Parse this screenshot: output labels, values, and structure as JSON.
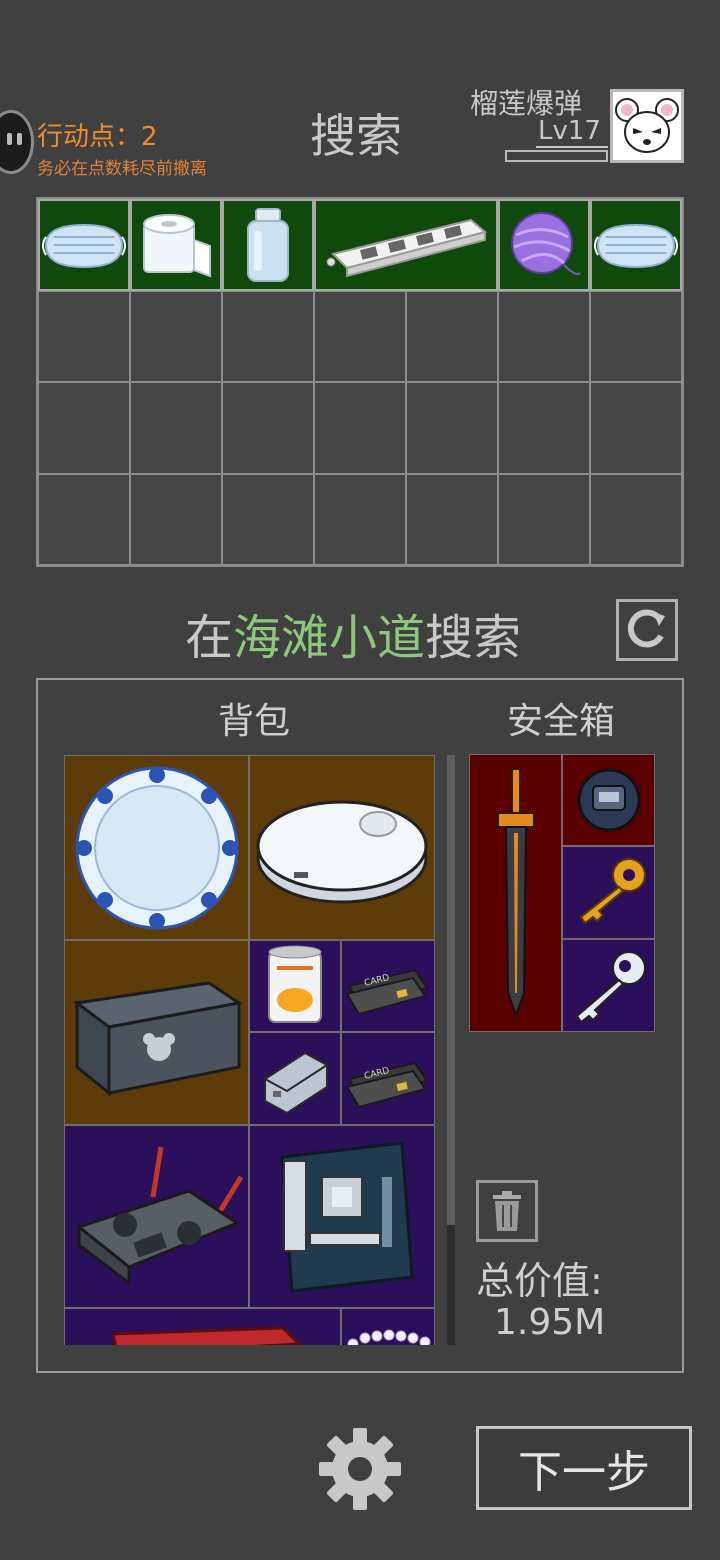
{
  "header": {
    "action_points_label": "行动点：2",
    "warning": "务必在点数耗尽前撤离",
    "title": "搜索",
    "player_name": "榴莲爆弹",
    "player_level": "Lv17"
  },
  "loot": {
    "items": [
      {
        "name": "face-mask",
        "icon": "face-mask-icon"
      },
      {
        "name": "toilet-paper",
        "icon": "toilet-paper-icon"
      },
      {
        "name": "bottle",
        "icon": "bottle-icon"
      },
      {
        "name": "power-strip",
        "icon": "power-strip-icon"
      },
      {
        "name": "yarn-ball",
        "icon": "yarn-ball-icon"
      },
      {
        "name": "face-mask",
        "icon": "face-mask-icon"
      }
    ],
    "grid_columns": 7,
    "grid_rows": 4
  },
  "location": {
    "prefix": "在",
    "place": "海滩小道",
    "suffix": "搜索"
  },
  "inventory": {
    "backpack_title": "背包",
    "safe_title": "安全箱",
    "backpack_items": [
      "porcelain-plate",
      "robot-vacuum",
      "storage-crate",
      "canned-peaches",
      "bank-card",
      "drone-battery",
      "bank-card",
      "remote-controller",
      "motherboard",
      "red-item",
      "pearl-necklace"
    ],
    "safe_items": [
      "sword",
      "watch",
      "gold-key",
      "silver-key"
    ],
    "card_text": "CARD",
    "total_label": "总价值:",
    "total_value": "1.95M"
  },
  "footer": {
    "next_label": "下一步"
  },
  "colors": {
    "background": "#404040",
    "action_points": "#f08a2a",
    "location_highlight": "#8cc97a",
    "found_item_bg": "#0f4a0c",
    "rarity_brown": "#5d3c0a",
    "rarity_purple": "#2c0f5a",
    "rarity_red": "#5a0000"
  }
}
